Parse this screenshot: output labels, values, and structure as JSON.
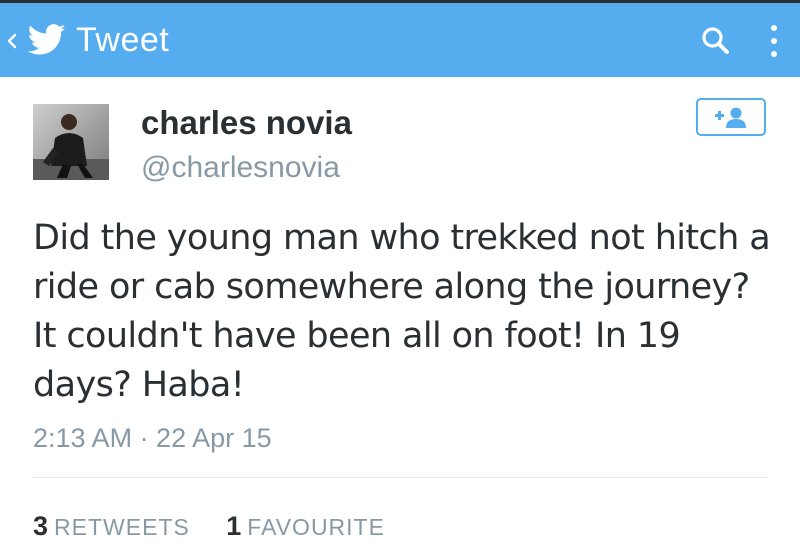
{
  "action_bar": {
    "title": "Tweet",
    "back_icon": "chevron-left-icon",
    "logo_icon": "twitter-bird-icon",
    "search_icon": "search-icon",
    "overflow_icon": "overflow-menu-icon",
    "color": "#55acee"
  },
  "tweet": {
    "author_name": "charles novia",
    "author_handle": "@charlesnovia",
    "avatar_icon": "avatar",
    "follow_icon": "add-user-icon",
    "text": "Did the young man who trekked not hitch a ride or cab somewhere along the journey? It couldn't have been all on foot! In 19 days? Haba!",
    "timestamp": "2:13 AM · 22 Apr 15"
  },
  "stats": {
    "retweets_count": "3",
    "retweets_label": "RETWEETS",
    "favourites_count": "1",
    "favourites_label": "FAVOURITE"
  },
  "colors": {
    "accent": "#55acee",
    "text_primary": "#292f33",
    "text_secondary": "#8899a6"
  }
}
